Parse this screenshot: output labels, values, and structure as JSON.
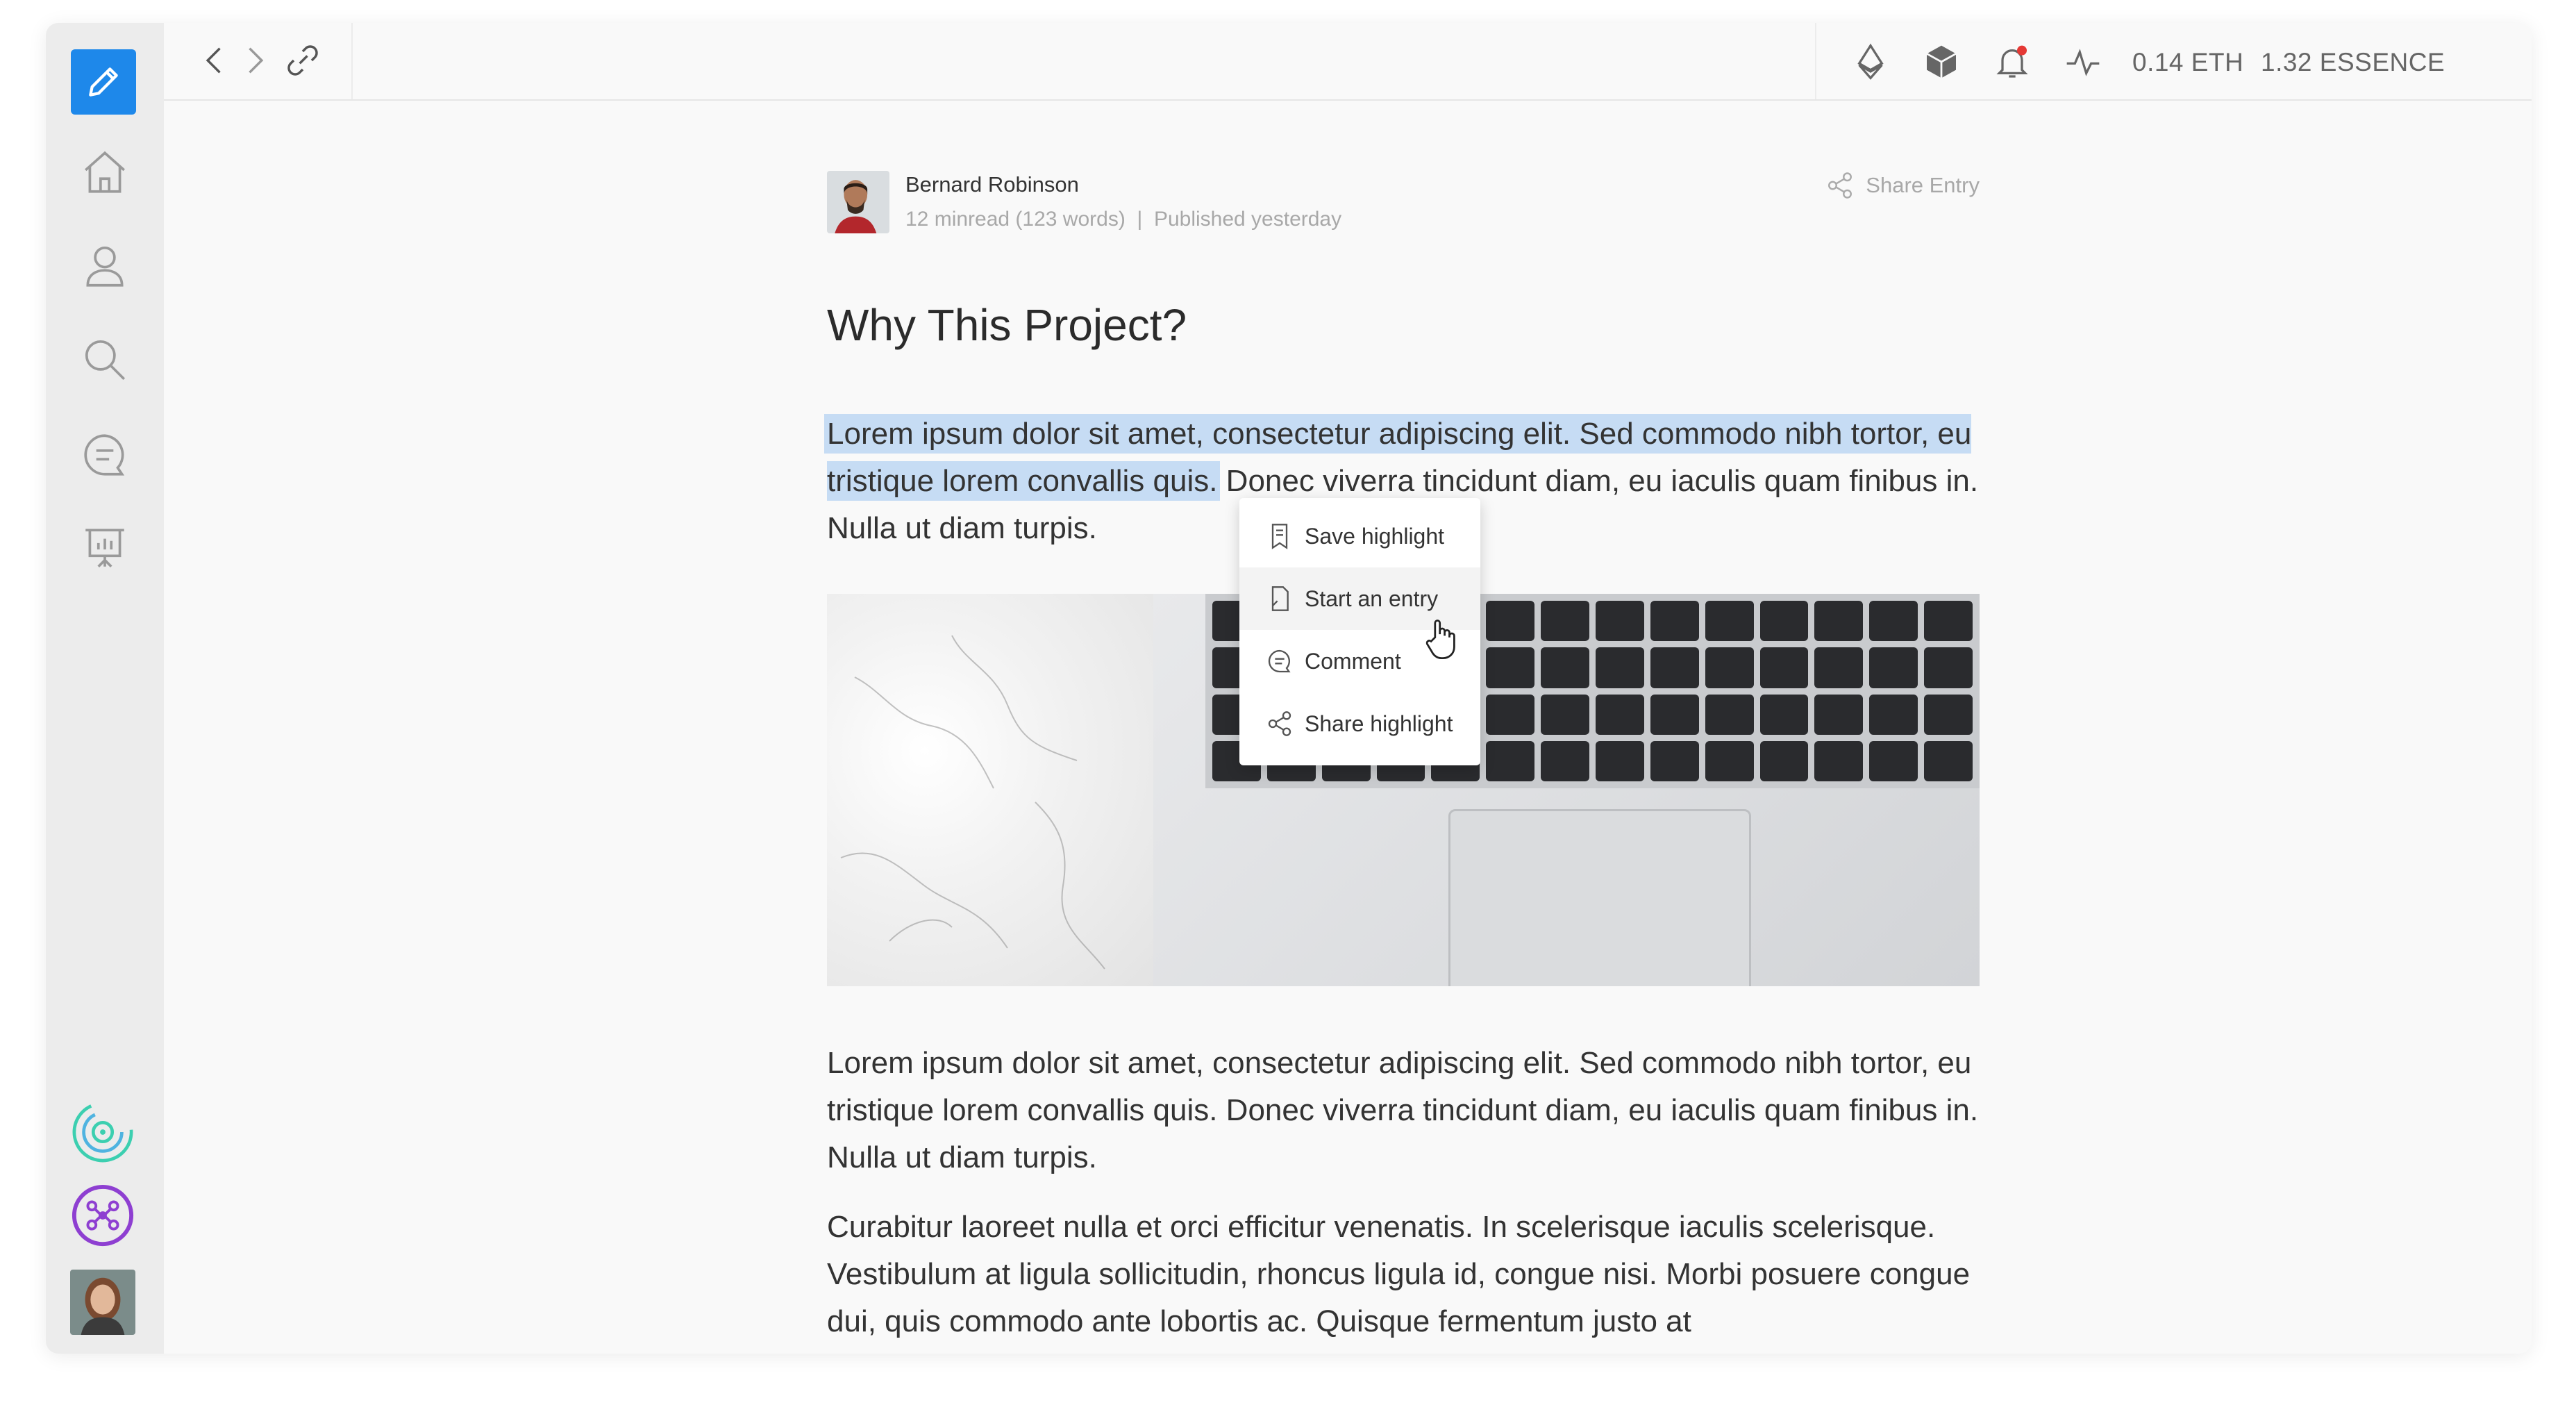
{
  "topbar": {
    "eth_balance": "0.14 ETH",
    "essence_balance": "1.32 ESSENCE"
  },
  "sidebar": {
    "items": [
      {
        "icon": "pencil-icon",
        "label": ""
      },
      {
        "icon": "home-icon"
      },
      {
        "icon": "user-icon"
      },
      {
        "icon": "search-icon"
      },
      {
        "icon": "chat-icon"
      },
      {
        "icon": "presentation-icon"
      }
    ],
    "bottom": [
      "spiral-app-icon",
      "network-app-icon",
      "user-avatar"
    ]
  },
  "article": {
    "author": "Bernard Robinson",
    "meta": "12 minread (123 words)  |  Published yesterday",
    "share_label": "Share Entry",
    "title": "Why This Project?",
    "p1_highlight": "Lorem ipsum dolor sit amet, consectetur adipiscing elit. Sed commodo nibh tortor, eu tristique lorem convallis quis.",
    "p1_rest": " Donec viverra tincidunt diam, eu iaculis quam finibus in. Nulla ut diam turpis.",
    "p2": "Lorem ipsum dolor sit amet, consectetur adipiscing elit. Sed commodo nibh tortor, eu tristique lorem convallis quis. Donec viverra tincidunt diam, eu iaculis quam finibus in. Nulla ut diam turpis.",
    "p3": "Curabitur laoreet nulla et orci efficitur venenatis. In scelerisque iaculis scelerisque. Vestibulum at ligula sollicitudin, rhoncus ligula id, congue nisi. Morbi posuere congue dui, quis commodo ante lobortis ac. Quisque fermentum justo at"
  },
  "context_menu": {
    "items": [
      {
        "label": "Save highlight",
        "icon": "bookmark-icon"
      },
      {
        "label": "Start an entry",
        "icon": "document-icon"
      },
      {
        "label": "Comment",
        "icon": "comment-icon"
      },
      {
        "label": "Share highlight",
        "icon": "share-icon"
      }
    ]
  },
  "colors": {
    "accent": "#1e88ea",
    "highlight": "#c6dcf4",
    "notification": "#e53935"
  }
}
